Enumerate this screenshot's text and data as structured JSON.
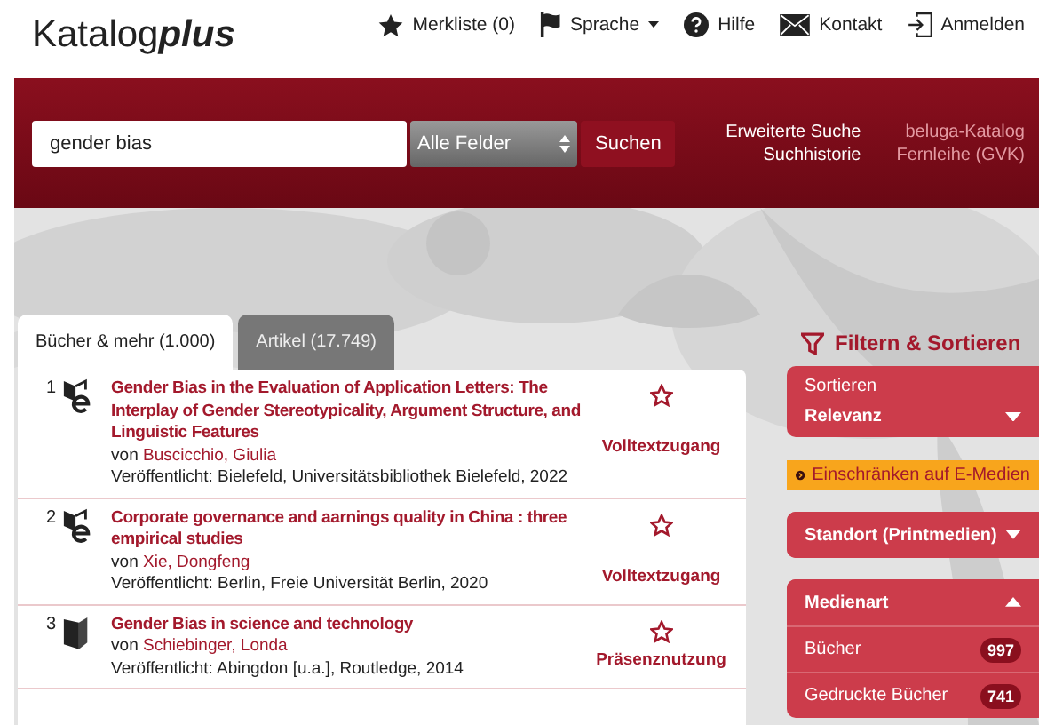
{
  "header": {
    "logo": {
      "main": "Katalog",
      "accent": "plus"
    },
    "nav": [
      {
        "label": "Merkliste (0)",
        "dropdown": false
      },
      {
        "label": "Sprache",
        "dropdown": true
      },
      {
        "label": "Hilfe",
        "dropdown": false
      },
      {
        "label": "Kontakt",
        "dropdown": false
      },
      {
        "label": "Anmelden",
        "dropdown": false
      }
    ]
  },
  "search": {
    "value": "gender bias",
    "field": "Alle Felder",
    "button": "Suchen",
    "links": [
      "Erweiterte Suche",
      "Suchhistorie"
    ],
    "external_links": [
      "beluga-Katalog",
      "Fernleihe (GVK)"
    ]
  },
  "tabs": [
    {
      "label": "Bücher & mehr (1.000)",
      "selected": true
    },
    {
      "label": "Artikel (17.749)",
      "selected": false
    }
  ],
  "results": [
    {
      "number": "1",
      "kind": "ebook",
      "title": "Gender Bias in the Evaluation of Application Letters: The Interplay of Gender Stereotypicality, Argument Structure, and Linguistic Features",
      "by": "von",
      "author": "Buscicchio, Giulia",
      "published": "Veröffentlicht: Bielefeld, Universitätsbibliothek Bielefeld, 2022",
      "access": "Volltextzugang"
    },
    {
      "number": "2",
      "kind": "ebook",
      "title": "Corporate governance and aarnings quality in China : three empirical studies",
      "by": "von",
      "author": "Xie, Dongfeng",
      "published": "Veröffentlicht: Berlin, Freie Universität Berlin, 2020",
      "access": "Volltextzugang"
    },
    {
      "number": "3",
      "kind": "book",
      "title": "Gender Bias in science and technology",
      "by": "von",
      "author": "Schiebinger, Londa",
      "published": "Veröffentlicht: Abingdon [u.a.], Routledge, 2014",
      "access": "Präsenznutzung"
    }
  ],
  "filter": {
    "title": "Filtern & Sortieren",
    "sort": {
      "label": "Sortieren",
      "value": "Relevanz"
    },
    "restrict": "Einschränken auf E-Medien",
    "facets": [
      {
        "label": "Standort (Printmedien)",
        "expanded": false
      },
      {
        "label": "Medienart",
        "expanded": true,
        "items": [
          {
            "label": "Bücher",
            "count": "997"
          },
          {
            "label": "Gedruckte Bücher",
            "count": "741"
          }
        ]
      }
    ]
  }
}
